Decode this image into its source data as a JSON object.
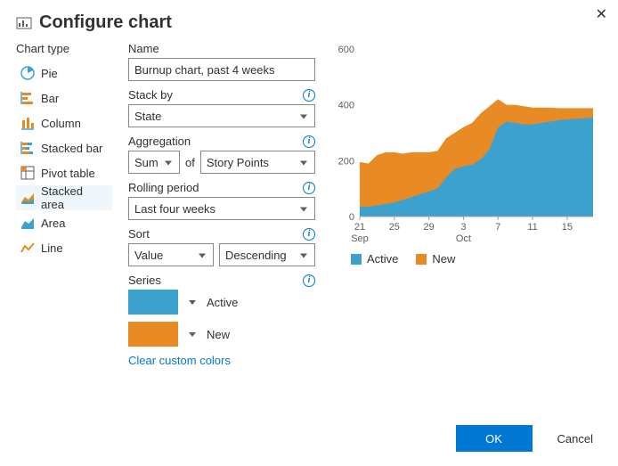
{
  "dialog": {
    "title": "Configure chart"
  },
  "chart_types": {
    "label": "Chart type",
    "items": [
      {
        "key": "pie",
        "label": "Pie"
      },
      {
        "key": "bar",
        "label": "Bar"
      },
      {
        "key": "column",
        "label": "Column"
      },
      {
        "key": "stacked-bar",
        "label": "Stacked bar"
      },
      {
        "key": "pivot",
        "label": "Pivot table"
      },
      {
        "key": "stacked-area",
        "label": "Stacked area"
      },
      {
        "key": "area",
        "label": "Area"
      },
      {
        "key": "line",
        "label": "Line"
      }
    ],
    "selected": "stacked-area"
  },
  "form": {
    "name_label": "Name",
    "name_value": "Burnup chart, past 4 weeks",
    "stack_by_label": "Stack by",
    "stack_by_value": "State",
    "aggregation_label": "Aggregation",
    "aggregation_func": "Sum",
    "aggregation_of": "of",
    "aggregation_field": "Story Points",
    "rolling_label": "Rolling period",
    "rolling_value": "Last four weeks",
    "sort_label": "Sort",
    "sort_by": "Value",
    "sort_dir": "Descending",
    "series_label": "Series",
    "series": [
      {
        "name": "Active",
        "color": "#3ca2cd"
      },
      {
        "name": "New",
        "color": "#e88b24"
      }
    ],
    "clear_colors": "Clear custom colors"
  },
  "legend": {
    "active": "Active",
    "new": "New"
  },
  "buttons": {
    "ok": "OK",
    "cancel": "Cancel"
  },
  "colors": {
    "active": "#3ca2cd",
    "new": "#e88b24",
    "accent": "#0078d4"
  },
  "chart_data": {
    "type": "area",
    "title": "",
    "xlabel": "",
    "ylabel": "",
    "ylim": [
      0,
      600
    ],
    "x": [
      "21 Sep",
      "22",
      "23",
      "24",
      "25",
      "26",
      "27",
      "28",
      "29",
      "30",
      "1",
      "2",
      "3 Oct",
      "4",
      "5",
      "6",
      "7",
      "8",
      "9",
      "10",
      "11",
      "12",
      "13",
      "14",
      "15",
      "16",
      "17",
      "18"
    ],
    "x_ticks_shown": [
      "21 Sep",
      "25",
      "29",
      "3 Oct",
      "7",
      "11",
      "15"
    ],
    "series": [
      {
        "name": "Active",
        "color": "#3ca2cd",
        "values": [
          35,
          35,
          40,
          45,
          50,
          60,
          70,
          80,
          90,
          100,
          140,
          170,
          180,
          185,
          205,
          240,
          320,
          340,
          335,
          330,
          330,
          335,
          340,
          345,
          348,
          350,
          352,
          355
        ]
      },
      {
        "name": "New",
        "color": "#e88b24",
        "values_stacked": [
          195,
          190,
          220,
          230,
          230,
          225,
          230,
          230,
          230,
          235,
          280,
          300,
          320,
          335,
          370,
          395,
          420,
          400,
          400,
          395,
          390,
          390,
          390,
          388,
          388,
          388,
          388,
          388
        ]
      }
    ]
  }
}
